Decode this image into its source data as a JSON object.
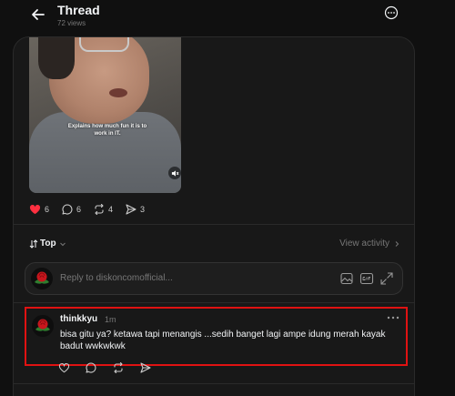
{
  "header": {
    "title": "Thread",
    "views": "72 views"
  },
  "post": {
    "video_caption": "Explains how much fun it is to work in IT.",
    "likes": "6",
    "comments": "6",
    "reposts": "4",
    "shares": "3",
    "like_color": "#ff3040"
  },
  "sort": {
    "label": "Top",
    "view_activity": "View activity"
  },
  "reply": {
    "placeholder": "Reply to diskoncomofficial..."
  },
  "comment": {
    "username": "thinkkyu",
    "time": "1m",
    "text": "bisa gitu ya? ketawa tapi menangis ...sedih banget lagi ampe idung merah kayak badut wwkwkwk",
    "highlight_color": "#e01212"
  },
  "icons": [
    "back-arrow-icon",
    "more-circle-icon",
    "mute-icon",
    "heart-icon",
    "comment-icon",
    "repost-icon",
    "share-icon",
    "sort-icon",
    "chevron-down-icon",
    "chevron-right-icon",
    "image-icon",
    "gif-icon",
    "expand-icon",
    "rose-avatar"
  ]
}
